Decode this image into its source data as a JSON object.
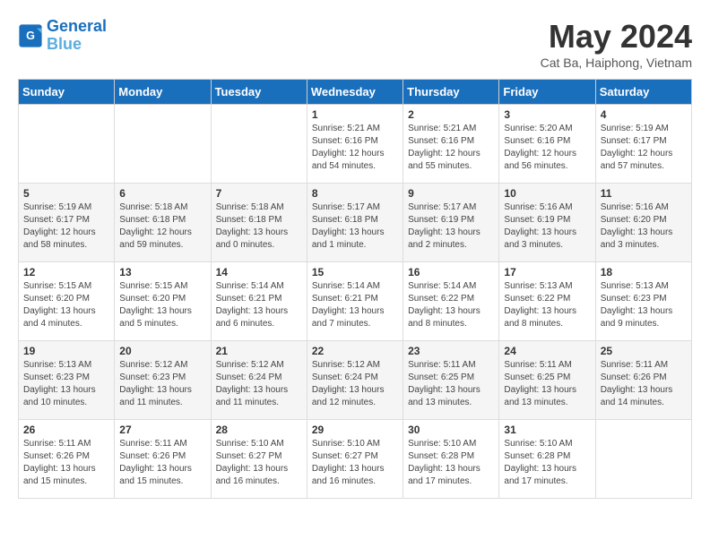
{
  "header": {
    "logo_line1": "General",
    "logo_line2": "Blue",
    "month": "May 2024",
    "location": "Cat Ba, Haiphong, Vietnam"
  },
  "weekdays": [
    "Sunday",
    "Monday",
    "Tuesday",
    "Wednesday",
    "Thursday",
    "Friday",
    "Saturday"
  ],
  "weeks": [
    [
      {
        "day": "",
        "info": ""
      },
      {
        "day": "",
        "info": ""
      },
      {
        "day": "",
        "info": ""
      },
      {
        "day": "1",
        "info": "Sunrise: 5:21 AM\nSunset: 6:16 PM\nDaylight: 12 hours\nand 54 minutes."
      },
      {
        "day": "2",
        "info": "Sunrise: 5:21 AM\nSunset: 6:16 PM\nDaylight: 12 hours\nand 55 minutes."
      },
      {
        "day": "3",
        "info": "Sunrise: 5:20 AM\nSunset: 6:16 PM\nDaylight: 12 hours\nand 56 minutes."
      },
      {
        "day": "4",
        "info": "Sunrise: 5:19 AM\nSunset: 6:17 PM\nDaylight: 12 hours\nand 57 minutes."
      }
    ],
    [
      {
        "day": "5",
        "info": "Sunrise: 5:19 AM\nSunset: 6:17 PM\nDaylight: 12 hours\nand 58 minutes."
      },
      {
        "day": "6",
        "info": "Sunrise: 5:18 AM\nSunset: 6:18 PM\nDaylight: 12 hours\nand 59 minutes."
      },
      {
        "day": "7",
        "info": "Sunrise: 5:18 AM\nSunset: 6:18 PM\nDaylight: 13 hours\nand 0 minutes."
      },
      {
        "day": "8",
        "info": "Sunrise: 5:17 AM\nSunset: 6:18 PM\nDaylight: 13 hours\nand 1 minute."
      },
      {
        "day": "9",
        "info": "Sunrise: 5:17 AM\nSunset: 6:19 PM\nDaylight: 13 hours\nand 2 minutes."
      },
      {
        "day": "10",
        "info": "Sunrise: 5:16 AM\nSunset: 6:19 PM\nDaylight: 13 hours\nand 3 minutes."
      },
      {
        "day": "11",
        "info": "Sunrise: 5:16 AM\nSunset: 6:20 PM\nDaylight: 13 hours\nand 3 minutes."
      }
    ],
    [
      {
        "day": "12",
        "info": "Sunrise: 5:15 AM\nSunset: 6:20 PM\nDaylight: 13 hours\nand 4 minutes."
      },
      {
        "day": "13",
        "info": "Sunrise: 5:15 AM\nSunset: 6:20 PM\nDaylight: 13 hours\nand 5 minutes."
      },
      {
        "day": "14",
        "info": "Sunrise: 5:14 AM\nSunset: 6:21 PM\nDaylight: 13 hours\nand 6 minutes."
      },
      {
        "day": "15",
        "info": "Sunrise: 5:14 AM\nSunset: 6:21 PM\nDaylight: 13 hours\nand 7 minutes."
      },
      {
        "day": "16",
        "info": "Sunrise: 5:14 AM\nSunset: 6:22 PM\nDaylight: 13 hours\nand 8 minutes."
      },
      {
        "day": "17",
        "info": "Sunrise: 5:13 AM\nSunset: 6:22 PM\nDaylight: 13 hours\nand 8 minutes."
      },
      {
        "day": "18",
        "info": "Sunrise: 5:13 AM\nSunset: 6:23 PM\nDaylight: 13 hours\nand 9 minutes."
      }
    ],
    [
      {
        "day": "19",
        "info": "Sunrise: 5:13 AM\nSunset: 6:23 PM\nDaylight: 13 hours\nand 10 minutes."
      },
      {
        "day": "20",
        "info": "Sunrise: 5:12 AM\nSunset: 6:23 PM\nDaylight: 13 hours\nand 11 minutes."
      },
      {
        "day": "21",
        "info": "Sunrise: 5:12 AM\nSunset: 6:24 PM\nDaylight: 13 hours\nand 11 minutes."
      },
      {
        "day": "22",
        "info": "Sunrise: 5:12 AM\nSunset: 6:24 PM\nDaylight: 13 hours\nand 12 minutes."
      },
      {
        "day": "23",
        "info": "Sunrise: 5:11 AM\nSunset: 6:25 PM\nDaylight: 13 hours\nand 13 minutes."
      },
      {
        "day": "24",
        "info": "Sunrise: 5:11 AM\nSunset: 6:25 PM\nDaylight: 13 hours\nand 13 minutes."
      },
      {
        "day": "25",
        "info": "Sunrise: 5:11 AM\nSunset: 6:26 PM\nDaylight: 13 hours\nand 14 minutes."
      }
    ],
    [
      {
        "day": "26",
        "info": "Sunrise: 5:11 AM\nSunset: 6:26 PM\nDaylight: 13 hours\nand 15 minutes."
      },
      {
        "day": "27",
        "info": "Sunrise: 5:11 AM\nSunset: 6:26 PM\nDaylight: 13 hours\nand 15 minutes."
      },
      {
        "day": "28",
        "info": "Sunrise: 5:10 AM\nSunset: 6:27 PM\nDaylight: 13 hours\nand 16 minutes."
      },
      {
        "day": "29",
        "info": "Sunrise: 5:10 AM\nSunset: 6:27 PM\nDaylight: 13 hours\nand 16 minutes."
      },
      {
        "day": "30",
        "info": "Sunrise: 5:10 AM\nSunset: 6:28 PM\nDaylight: 13 hours\nand 17 minutes."
      },
      {
        "day": "31",
        "info": "Sunrise: 5:10 AM\nSunset: 6:28 PM\nDaylight: 13 hours\nand 17 minutes."
      },
      {
        "day": "",
        "info": ""
      }
    ]
  ]
}
